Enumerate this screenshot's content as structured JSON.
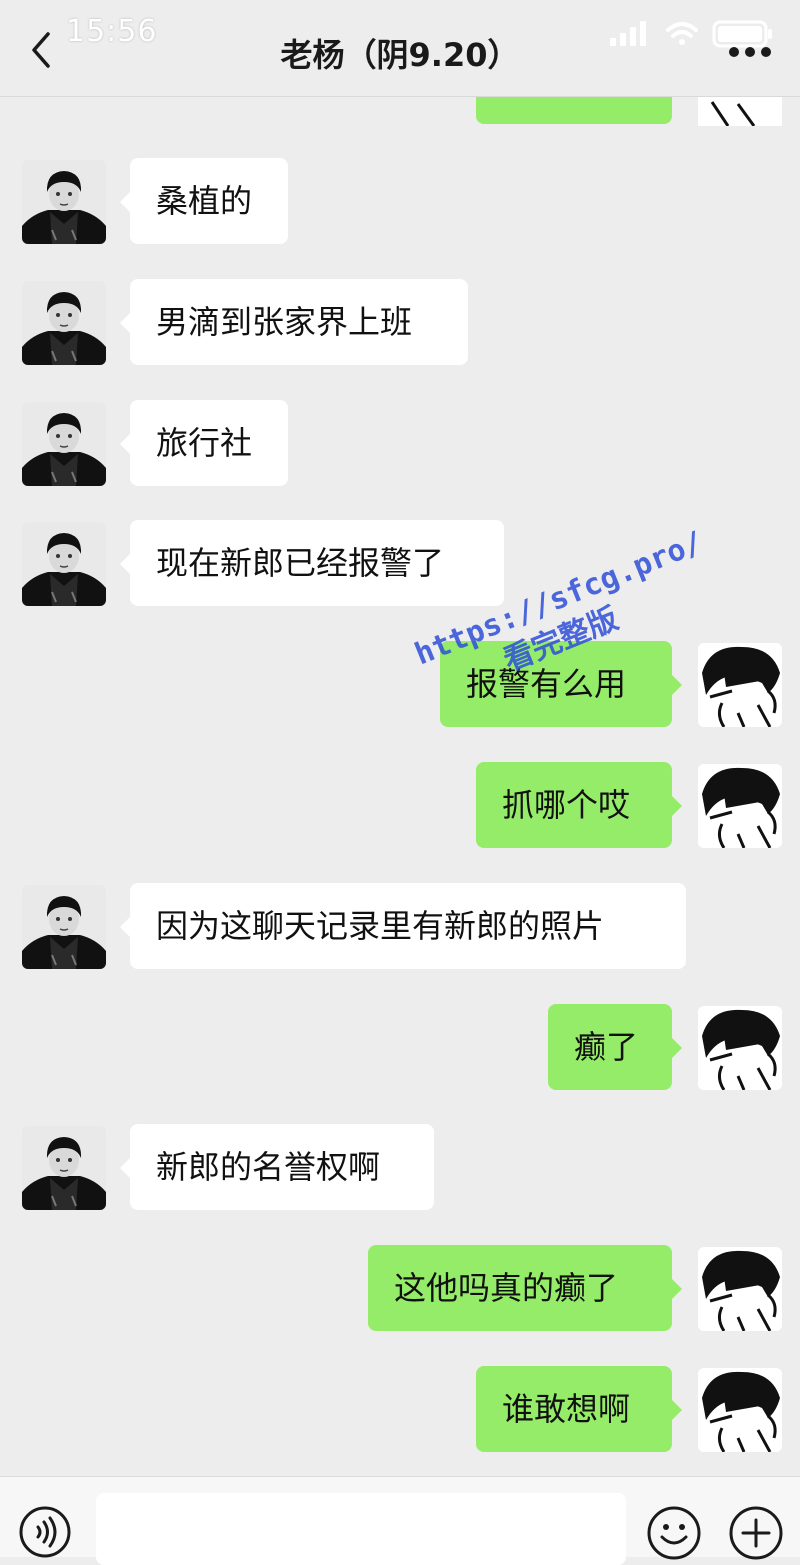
{
  "status_bar": {
    "time": "15:56"
  },
  "header": {
    "title": "老杨（阴9.20）"
  },
  "watermark": {
    "url": "https://sfcg.pro/",
    "text": "看完整版"
  },
  "messages": [
    {
      "side": "left",
      "text": "桑植的"
    },
    {
      "side": "left",
      "text": "男滴到张家界上班"
    },
    {
      "side": "left",
      "text": "旅行社"
    },
    {
      "side": "left",
      "text": "现在新郎已经报警了"
    },
    {
      "side": "right",
      "text": "报警有么用"
    },
    {
      "side": "right",
      "text": "抓哪个哎"
    },
    {
      "side": "left",
      "text": "因为这聊天记录里有新郎的照片"
    },
    {
      "side": "right",
      "text": "癫了"
    },
    {
      "side": "left",
      "text": "新郎的名誉权啊"
    },
    {
      "side": "right",
      "text": "这他吗真的癫了"
    },
    {
      "side": "right",
      "text": "谁敢想啊"
    }
  ],
  "icons": {
    "back": "chevron-left-icon",
    "more": "more-dots-icon",
    "voice": "voice-icon",
    "emoji": "emoji-icon",
    "plus": "plus-icon"
  },
  "colors": {
    "background": "#ededed",
    "incoming_bubble": "#ffffff",
    "outgoing_bubble": "#95ec69",
    "watermark": "#2f4fd9"
  },
  "input": {
    "value": ""
  }
}
